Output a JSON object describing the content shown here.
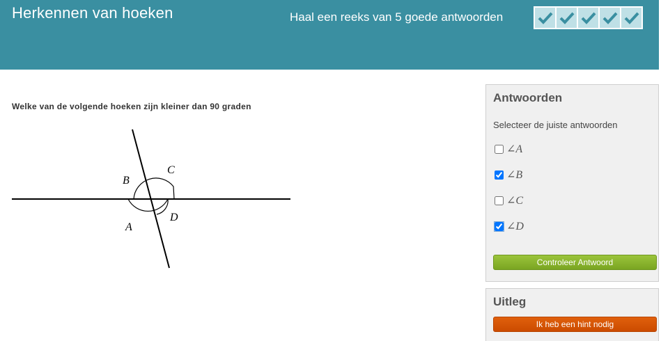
{
  "header": {
    "title": "Herkennen van hoeken",
    "streak_text": "Haal een reeks van 5 goede antwoorden",
    "streak_checks": 5,
    "color": "#3a8fa1"
  },
  "question": {
    "text": "Welke van de volgende hoeken zijn kleiner dan 90 graden",
    "figure_labels": {
      "a": "A",
      "b": "B",
      "c": "C",
      "d": "D"
    }
  },
  "answers_panel": {
    "title": "Antwoorden",
    "instruction": "Selecteer de juiste antwoorden",
    "options": [
      {
        "label": "∠A",
        "checked": false
      },
      {
        "label": "∠B",
        "checked": true
      },
      {
        "label": "∠C",
        "checked": false
      },
      {
        "label": "∠D",
        "checked": true
      }
    ],
    "check_button": "Controleer Antwoord"
  },
  "uitleg_panel": {
    "title": "Uitleg",
    "hint_button": "Ik heb een hint nodig"
  },
  "colors": {
    "check_button": "#8ab82e",
    "hint_button": "#d65a08",
    "checkmark": "#3a8fa1"
  }
}
